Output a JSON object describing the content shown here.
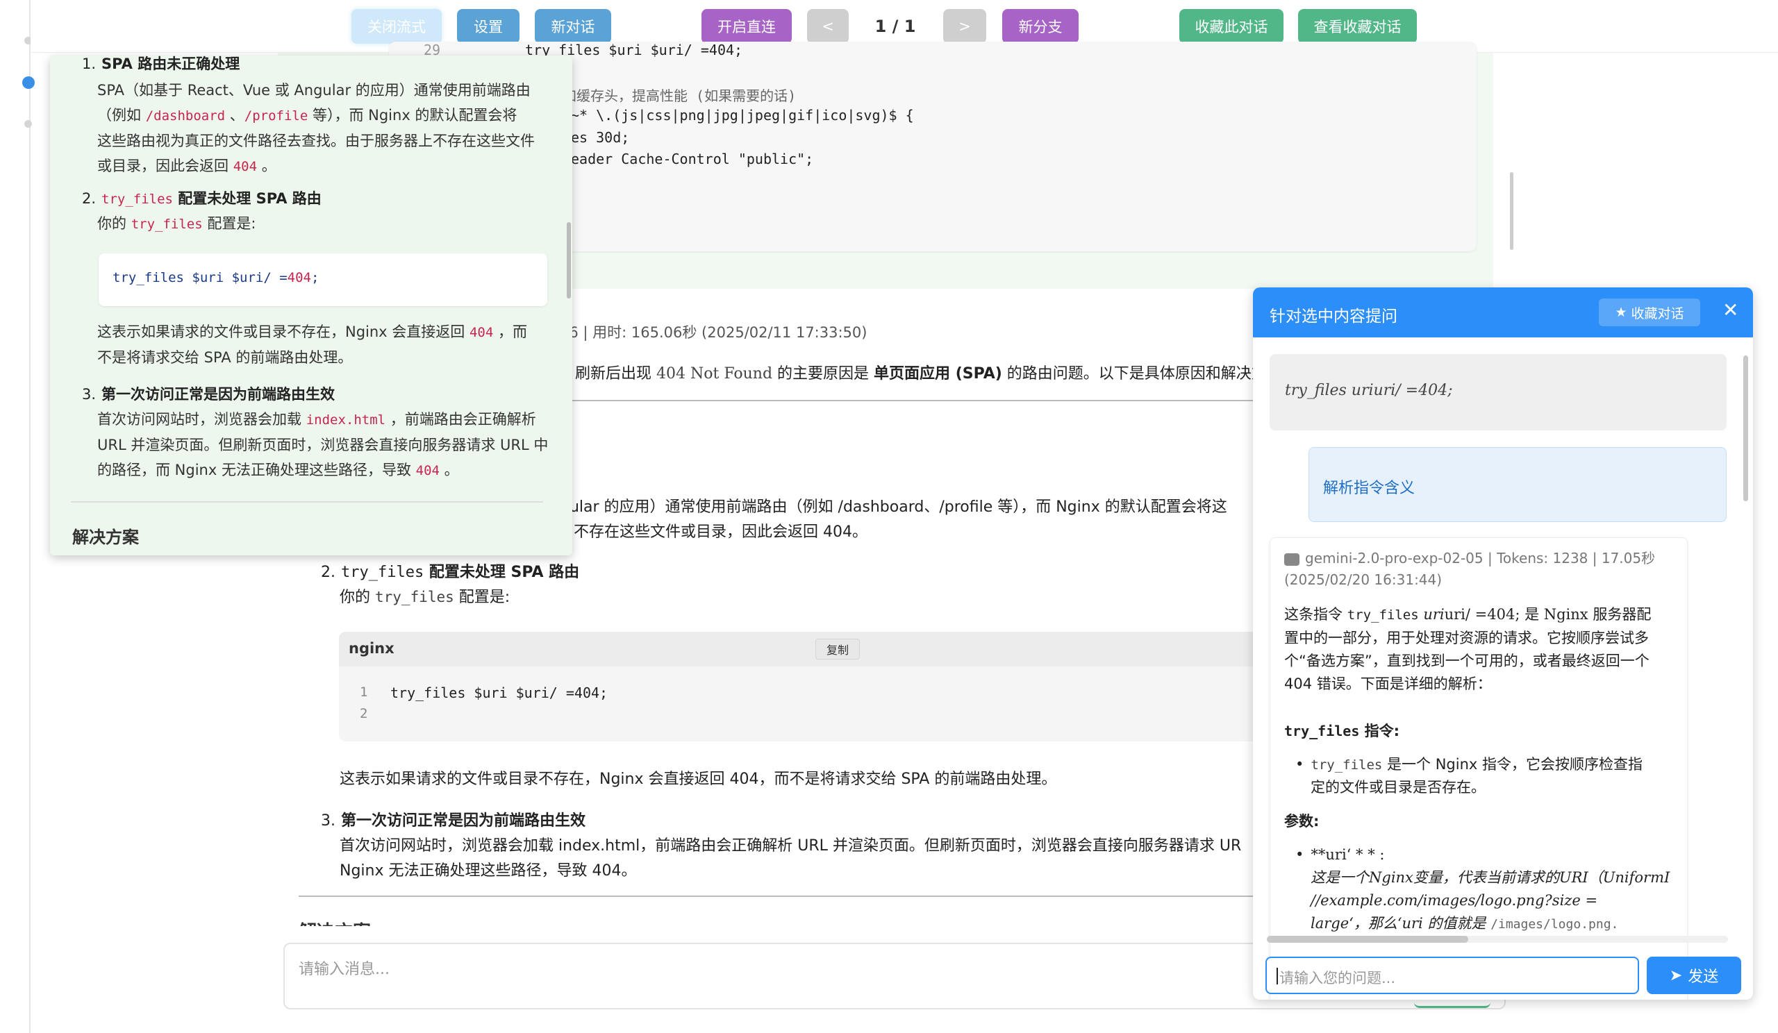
{
  "toolbar": {
    "close_stream": "关闭流式",
    "settings": "设置",
    "new_chat": "新对话",
    "direct_connect": "开启直连",
    "prev": "<",
    "page": "1 / 1",
    "next": ">",
    "new_branch": "新分支",
    "bookmark_chat": "收藏此对话",
    "view_bookmarks": "查看收藏对话"
  },
  "colors": {
    "close_stream": "#cfe9fb",
    "settings": "#5ba3d6",
    "direct_connect": "#a764c6",
    "pager": "#cfcfcf",
    "bookmark": "#52b788",
    "panel_blue": "#2c8ef8",
    "popup_bg": "#eef7ee"
  },
  "top_code": {
    "line_num": "29",
    "lines": [
      "try_files $uri $uri/ =404;",
      "",
      "加缓存头，提高性能 (如果需要的话)",
      "~* \\.(js|css|png|jpg|jpeg|gif|ico|svg)$ {",
      "es 30d;",
      "eader Cache-Control \"public\";"
    ]
  },
  "message": {
    "meta": "06 | 用时: 165.06秒 (2025/02/11 17:33:50)",
    "intro_pre": "刷新后出现 ",
    "intro_code": "404 Not Found",
    "intro_mid": " 的主要原因是 ",
    "intro_bold": "单页面应用 (SPA)",
    "intro_post": " 的路由问题。以下是具体原因和解决方",
    "item1_line1": "gular 的应用）通常使用前端路由（例如 /dashboard、/profile 等），而 Nginx 的默认配置会将这",
    "item1_line2": "不存在这些文件或目录，因此会返回 404。",
    "item2_num": "2.",
    "item2_code": "try_files",
    "item2_title": " 配置未处理 SPA 路由",
    "item2_sub_pre": "你的 ",
    "item2_sub_code": "try_files",
    "item2_sub_post": " 配置是:",
    "code_lang": "nginx",
    "code_copy": "复制",
    "code_ln1": "1",
    "code_ln2": "2",
    "code_line1": "try_files $uri $uri/ =404;",
    "item2_after": "这表示如果请求的文件或目录不存在，Nginx 会直接返回 404，而不是将请求交给 SPA 的前端路由处理。",
    "item3_num": "3.",
    "item3_title": "第一次访问正常是因为前端路由生效",
    "item3_l1": "首次访问网站时，浏览器会加载 index.html，前端路由会正确解析 URL 并渲染页面。但刷新页面时，浏览器会直接向服务器请求 UR",
    "item3_l2": "Nginx 无法正确处理这些路径，导致 404。",
    "next_heading": "解决方案",
    "input_placeholder": "请输入消息..."
  },
  "popup": {
    "item1_num": "1.",
    "item1_title": "SPA 路由未正确处理",
    "item1_t1": "SPA（如基于 React、Vue 或 Angular 的应用）通常使用前端路由",
    "item1_t2_pre": "（例如 ",
    "item1_c1": "/dashboard",
    "item1_t2_sep": " 、",
    "item1_c2": "/profile",
    "item1_t2_post": " 等），而 Nginx 的默认配置会将",
    "item1_t3": "这些路由视为真正的文件路径去查找。由于服务器上不存在这些文件",
    "item1_t4_pre": "或目录，因此会返回 ",
    "item1_t4_code": "404",
    "item1_t4_post": " 。",
    "item2_num": "2.",
    "item2_code": "try_files",
    "item2_title": " 配置未处理 SPA 路由",
    "item2_sub_pre": "你的 ",
    "item2_sub_code": "try_files",
    "item2_sub_post": " 配置是:",
    "code_pre": "try_files $uri $uri/ =",
    "code_num": "404",
    "code_post": ";",
    "after1_pre": "这表示如果请求的文件或目录不存在，Nginx 会直接返回 ",
    "after1_code": "404",
    "after1_post": " ，而",
    "after2": "不是将请求交给 SPA 的前端路由处理。",
    "item3_num": "3.",
    "item3_title": "第一次访问正常是因为前端路由生效",
    "item3_l1_pre": "首次访问网站时，浏览器会加载 ",
    "item3_l1_code": "index.html",
    "item3_l1_post": " ，前端路由会正确解析",
    "item3_l2": "URL 并渲染页面。但刷新页面时，浏览器会直接向服务器请求 URL 中",
    "item3_l3_pre": "的路径，而 Nginx 无法正确处理这些路径，导致 ",
    "item3_l3_code": "404",
    "item3_l3_post": " 。",
    "solution": "解决方案"
  },
  "panel": {
    "title": "针对选中内容提问",
    "bookmark": "收藏对话",
    "close": "✕",
    "quote": "try_files uriuri/ =404;",
    "question": "解析指令含义",
    "model_meta1": "gemini-2.0-pro-exp-02-05 | Tokens: 1238 | 17.05秒",
    "model_meta2": "(2025/02/20 16:31:44)",
    "a_p1_pre": "这条指令 ",
    "a_p1_code": "try_files",
    "a_p1_math": " uri",
    "a_p1_post": "uri/ =404; 是 Nginx 服务器配",
    "a_p1_l2": "置中的一部分，用于处理对资源的请求。它按顺序尝试多",
    "a_p1_l3": "个“备选方案”，直到找到一个可用的，或者最终返回一个",
    "a_p1_l4": "404 错误。下面是详细的解析：",
    "a_h1_code": "try_files",
    "a_h1": " 指令:",
    "a_li1_code": "try_files",
    "a_li1_l1": " 是一个 Nginx 指令，它会按顺序检查指",
    "a_li1_l2": "定的文件或目录是否存在。",
    "a_h2": "参数:",
    "a_li2_l1": "**uri‘ * * :",
    "a_li2_l2": "这是一个Nginx变量，代表当前请求的URI（UniformI",
    "a_li2_l3": "//example.com/images/logo.png?size =",
    "a_li2_l4_pre": "large‘，那么‘uri 的值就是 ",
    "a_li2_l4_code": "/images/logo.png.",
    "input_placeholder": "请输入您的问题...",
    "send": "发送"
  }
}
